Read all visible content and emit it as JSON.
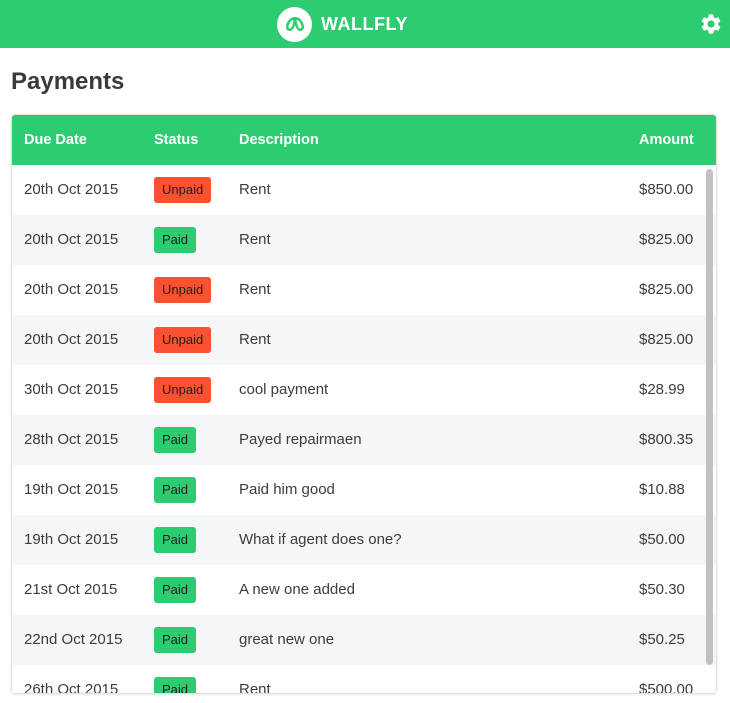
{
  "app": {
    "brand": "WALLFLY",
    "colors": {
      "accent": "#2ecc71",
      "paid": "#2ecc71",
      "unpaid": "#fa5230"
    }
  },
  "page": {
    "title": "Payments"
  },
  "table": {
    "headers": {
      "due_date": "Due Date",
      "status": "Status",
      "description": "Description",
      "amount": "Amount"
    },
    "rows": [
      {
        "date": "20th Oct 2015",
        "status": "Unpaid",
        "description": "Rent",
        "amount": "$850.00"
      },
      {
        "date": "20th Oct 2015",
        "status": "Paid",
        "description": "Rent",
        "amount": "$825.00"
      },
      {
        "date": "20th Oct 2015",
        "status": "Unpaid",
        "description": "Rent",
        "amount": "$825.00"
      },
      {
        "date": "20th Oct 2015",
        "status": "Unpaid",
        "description": "Rent",
        "amount": "$825.00"
      },
      {
        "date": "30th Oct 2015",
        "status": "Unpaid",
        "description": "cool payment",
        "amount": "$28.99"
      },
      {
        "date": "28th Oct 2015",
        "status": "Paid",
        "description": "Payed repairmaen",
        "amount": "$800.35"
      },
      {
        "date": "19th Oct 2015",
        "status": "Paid",
        "description": "Paid him good",
        "amount": "$10.88"
      },
      {
        "date": "19th Oct 2015",
        "status": "Paid",
        "description": "What if agent does one?",
        "amount": "$50.00"
      },
      {
        "date": "21st Oct 2015",
        "status": "Paid",
        "description": "A new one added",
        "amount": "$50.30"
      },
      {
        "date": "22nd Oct 2015",
        "status": "Paid",
        "description": "great new one",
        "amount": "$50.25"
      },
      {
        "date": "26th Oct 2015",
        "status": "Paid",
        "description": "Rent",
        "amount": "$500.00"
      }
    ]
  }
}
